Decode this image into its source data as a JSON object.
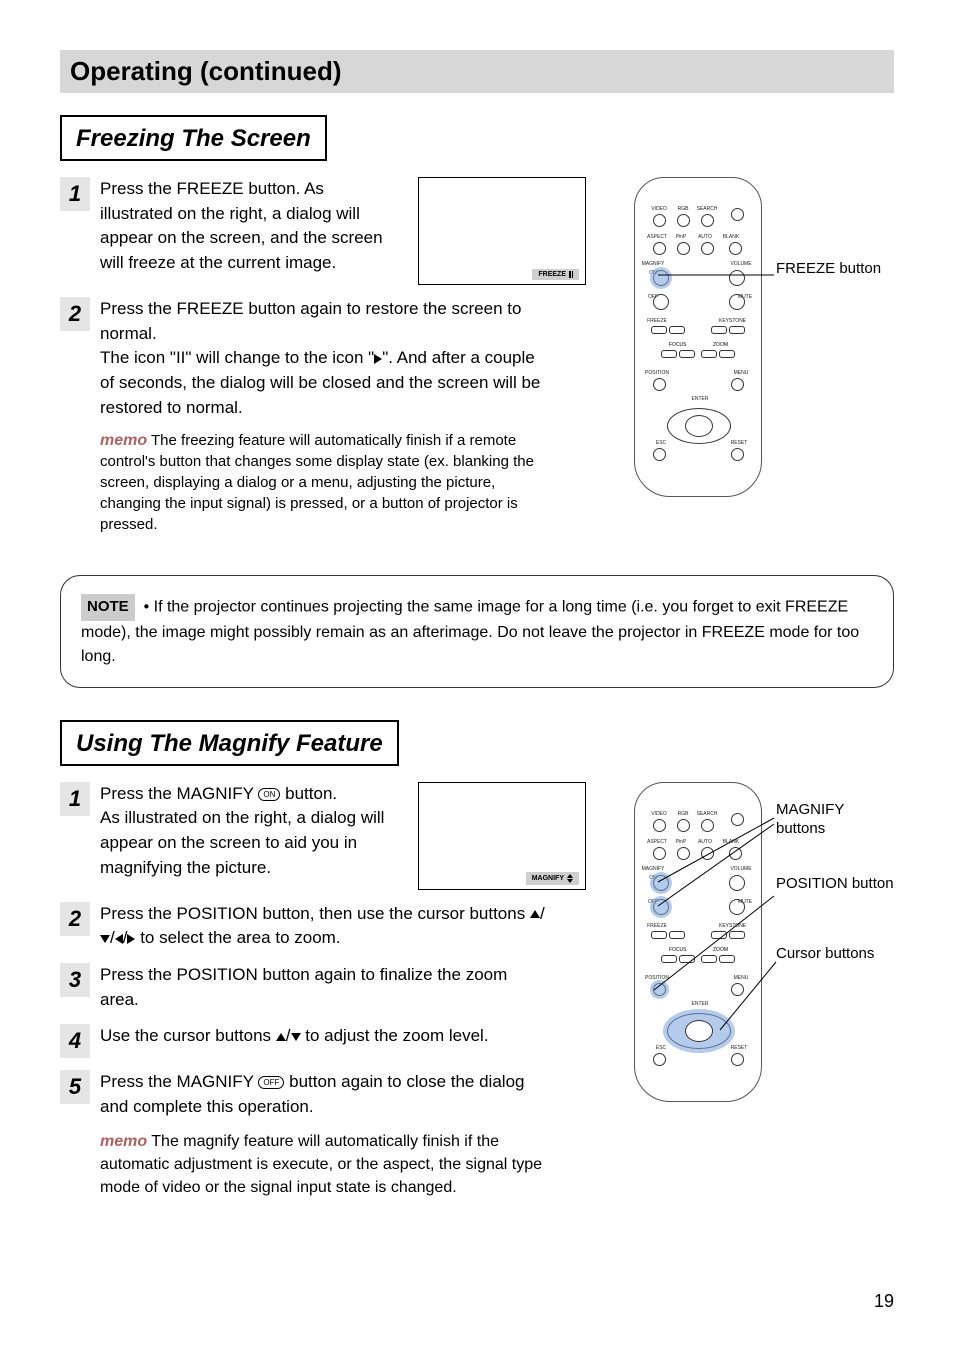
{
  "page_title": "Operating (continued)",
  "page_number": "19",
  "section1": {
    "title": "Freezing The Screen",
    "freeze_indicator": "FREEZE",
    "steps": {
      "n1": "1",
      "s1": "Press the FREEZE button. As illustrated on the right, a dialog will appear on the screen, and the screen will freeze at the current image.",
      "n2": "2",
      "s2a": "Press the FREEZE button again to restore the screen to normal.",
      "s2b_pre": "The icon \"II\" will change to the icon \"",
      "s2b_post": "\".  And after a couple of seconds, the dialog will be closed and the screen will be restored to normal."
    },
    "memo_label": "memo",
    "memo": " The freezing feature will automatically finish if a remote control's button that changes some display state (ex. blanking the screen, displaying a dialog or a menu, adjusting the picture, changing the input signal) is pressed, or a button of projector is pressed.",
    "remote_callout": "FREEZE button"
  },
  "note": {
    "label": "NOTE",
    "bullet": "•",
    "text": " If the projector continues projecting the same image for a long time (i.e. you forget to exit FREEZE mode), the image might possibly remain as an afterimage. Do not leave the projector in FREEZE mode for too long."
  },
  "section2": {
    "title": "Using The Magnify Feature",
    "magnify_indicator": "MAGNIFY",
    "steps": {
      "n1": "1",
      "s1a": "Press the MAGNIFY ",
      "on": "ON",
      "s1b": " button.",
      "s1c": "As illustrated on the right, a dialog will appear on the screen to aid you in magnifying the picture.",
      "n2": "2",
      "s2a": "Press the POSITION button, then use the cursor buttons ",
      "s2b": " to select the area to zoom.",
      "n3": "3",
      "s3": "Press the POSITION button again to finalize the zoom area.",
      "n4": "4",
      "s4a": "Use the cursor buttons ",
      "s4b": " to adjust the zoom level.",
      "n5": "5",
      "s5a": "Press the MAGNIFY ",
      "off": "OFF",
      "s5b": " button again to close the dialog and complete this operation."
    },
    "memo_label": "memo",
    "memo": " The magnify feature will automatically finish if the automatic adjustment is execute, or the aspect, the signal type mode of video or the signal input state is changed.",
    "callouts": {
      "magnify": "MAGNIFY buttons",
      "position": "POSITION button",
      "cursor": "Cursor buttons"
    }
  },
  "remote": {
    "row1": [
      "VIDEO",
      "RGB",
      "SEARCH"
    ],
    "row2": [
      "ASPECT",
      "PinP",
      "AUTO",
      "BLANK"
    ],
    "magnify": "MAGNIFY",
    "on": "ON",
    "off": "OFF",
    "volume": "VOLUME",
    "mute": "MUTE",
    "freeze": "FREEZE",
    "keystone": "KEYSTONE",
    "focus": "FOCUS",
    "zoom": "ZOOM",
    "position": "POSITION",
    "menu": "MENU",
    "enter": "ENTER",
    "esc": "ESC",
    "reset": "RESET"
  }
}
